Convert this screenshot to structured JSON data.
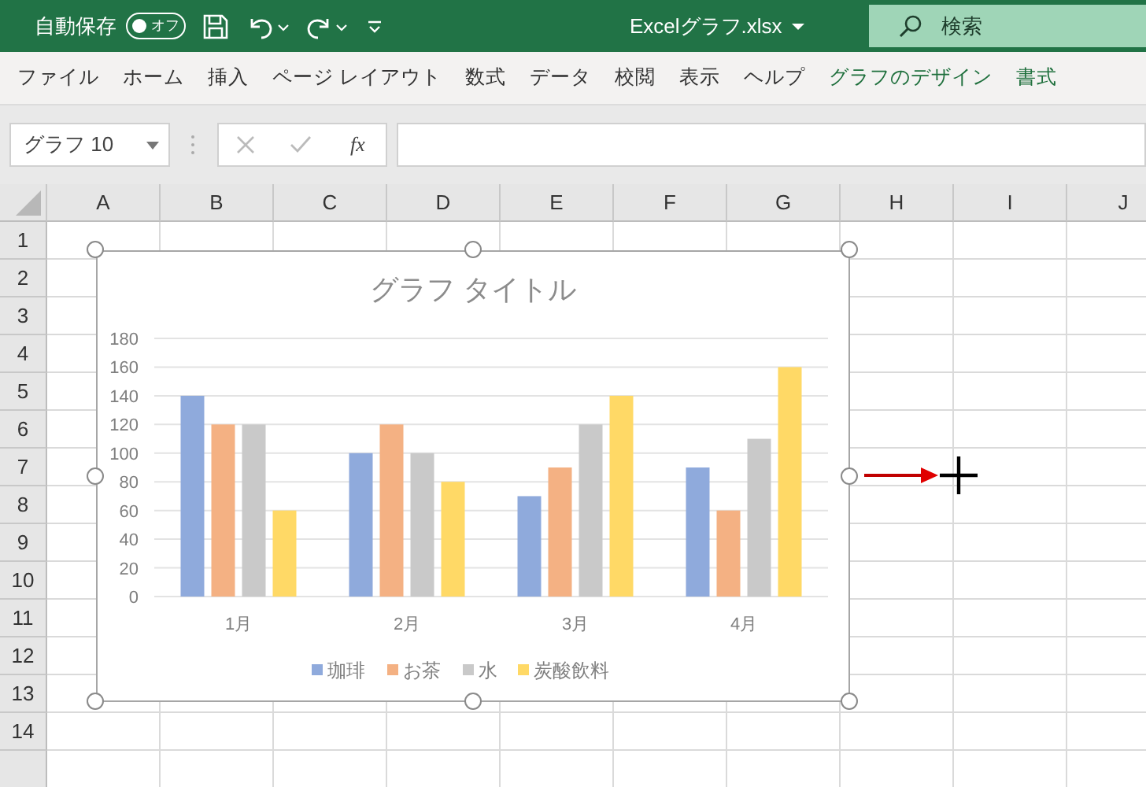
{
  "title_bar": {
    "autosave_label": "自動保存",
    "autosave": {
      "label": "オフ",
      "on": false
    },
    "filename": "Excelグラフ.xlsx",
    "search": {
      "placeholder": "検索"
    }
  },
  "ribbon_tabs": [
    {
      "label": "ファイル",
      "contextual": false
    },
    {
      "label": "ホーム",
      "contextual": false
    },
    {
      "label": "挿入",
      "contextual": false
    },
    {
      "label": "ページ レイアウト",
      "contextual": false
    },
    {
      "label": "数式",
      "contextual": false
    },
    {
      "label": "データ",
      "contextual": false
    },
    {
      "label": "校閲",
      "contextual": false
    },
    {
      "label": "表示",
      "contextual": false
    },
    {
      "label": "ヘルプ",
      "contextual": false
    },
    {
      "label": "グラフのデザイン",
      "contextual": true
    },
    {
      "label": "書式",
      "contextual": true
    }
  ],
  "formula_bar": {
    "name_box": "グラフ 10",
    "function_label": "fx"
  },
  "sheet": {
    "columns": [
      "A",
      "B",
      "C",
      "D",
      "E",
      "F",
      "G",
      "H",
      "I",
      "J"
    ],
    "rows": [
      "1",
      "2",
      "3",
      "4",
      "5",
      "6",
      "7",
      "8",
      "9",
      "10",
      "11",
      "12",
      "13",
      "14"
    ],
    "chart": {
      "chart_data": {
        "type": "bar",
        "title": "グラフ タイトル",
        "grid": true,
        "legend": true,
        "categories": [
          "1月",
          "2月",
          "3月",
          "4月"
        ],
        "ylim": [
          0,
          180
        ],
        "yticks": [
          0,
          20,
          40,
          60,
          80,
          100,
          120,
          140,
          160,
          180
        ],
        "series": [
          {
            "name": "珈琲",
            "color": "#8faadc",
            "values": [
              140,
              100,
              70,
              90
            ]
          },
          {
            "name": "お茶",
            "color": "#f4b183",
            "values": [
              120,
              120,
              90,
              60
            ]
          },
          {
            "name": "水",
            "color": "#c9c9c9",
            "values": [
              120,
              100,
              120,
              110
            ]
          },
          {
            "name": "炭酸飲料",
            "color": "#ffd966",
            "values": [
              60,
              80,
              140,
              160
            ]
          }
        ]
      }
    }
  }
}
